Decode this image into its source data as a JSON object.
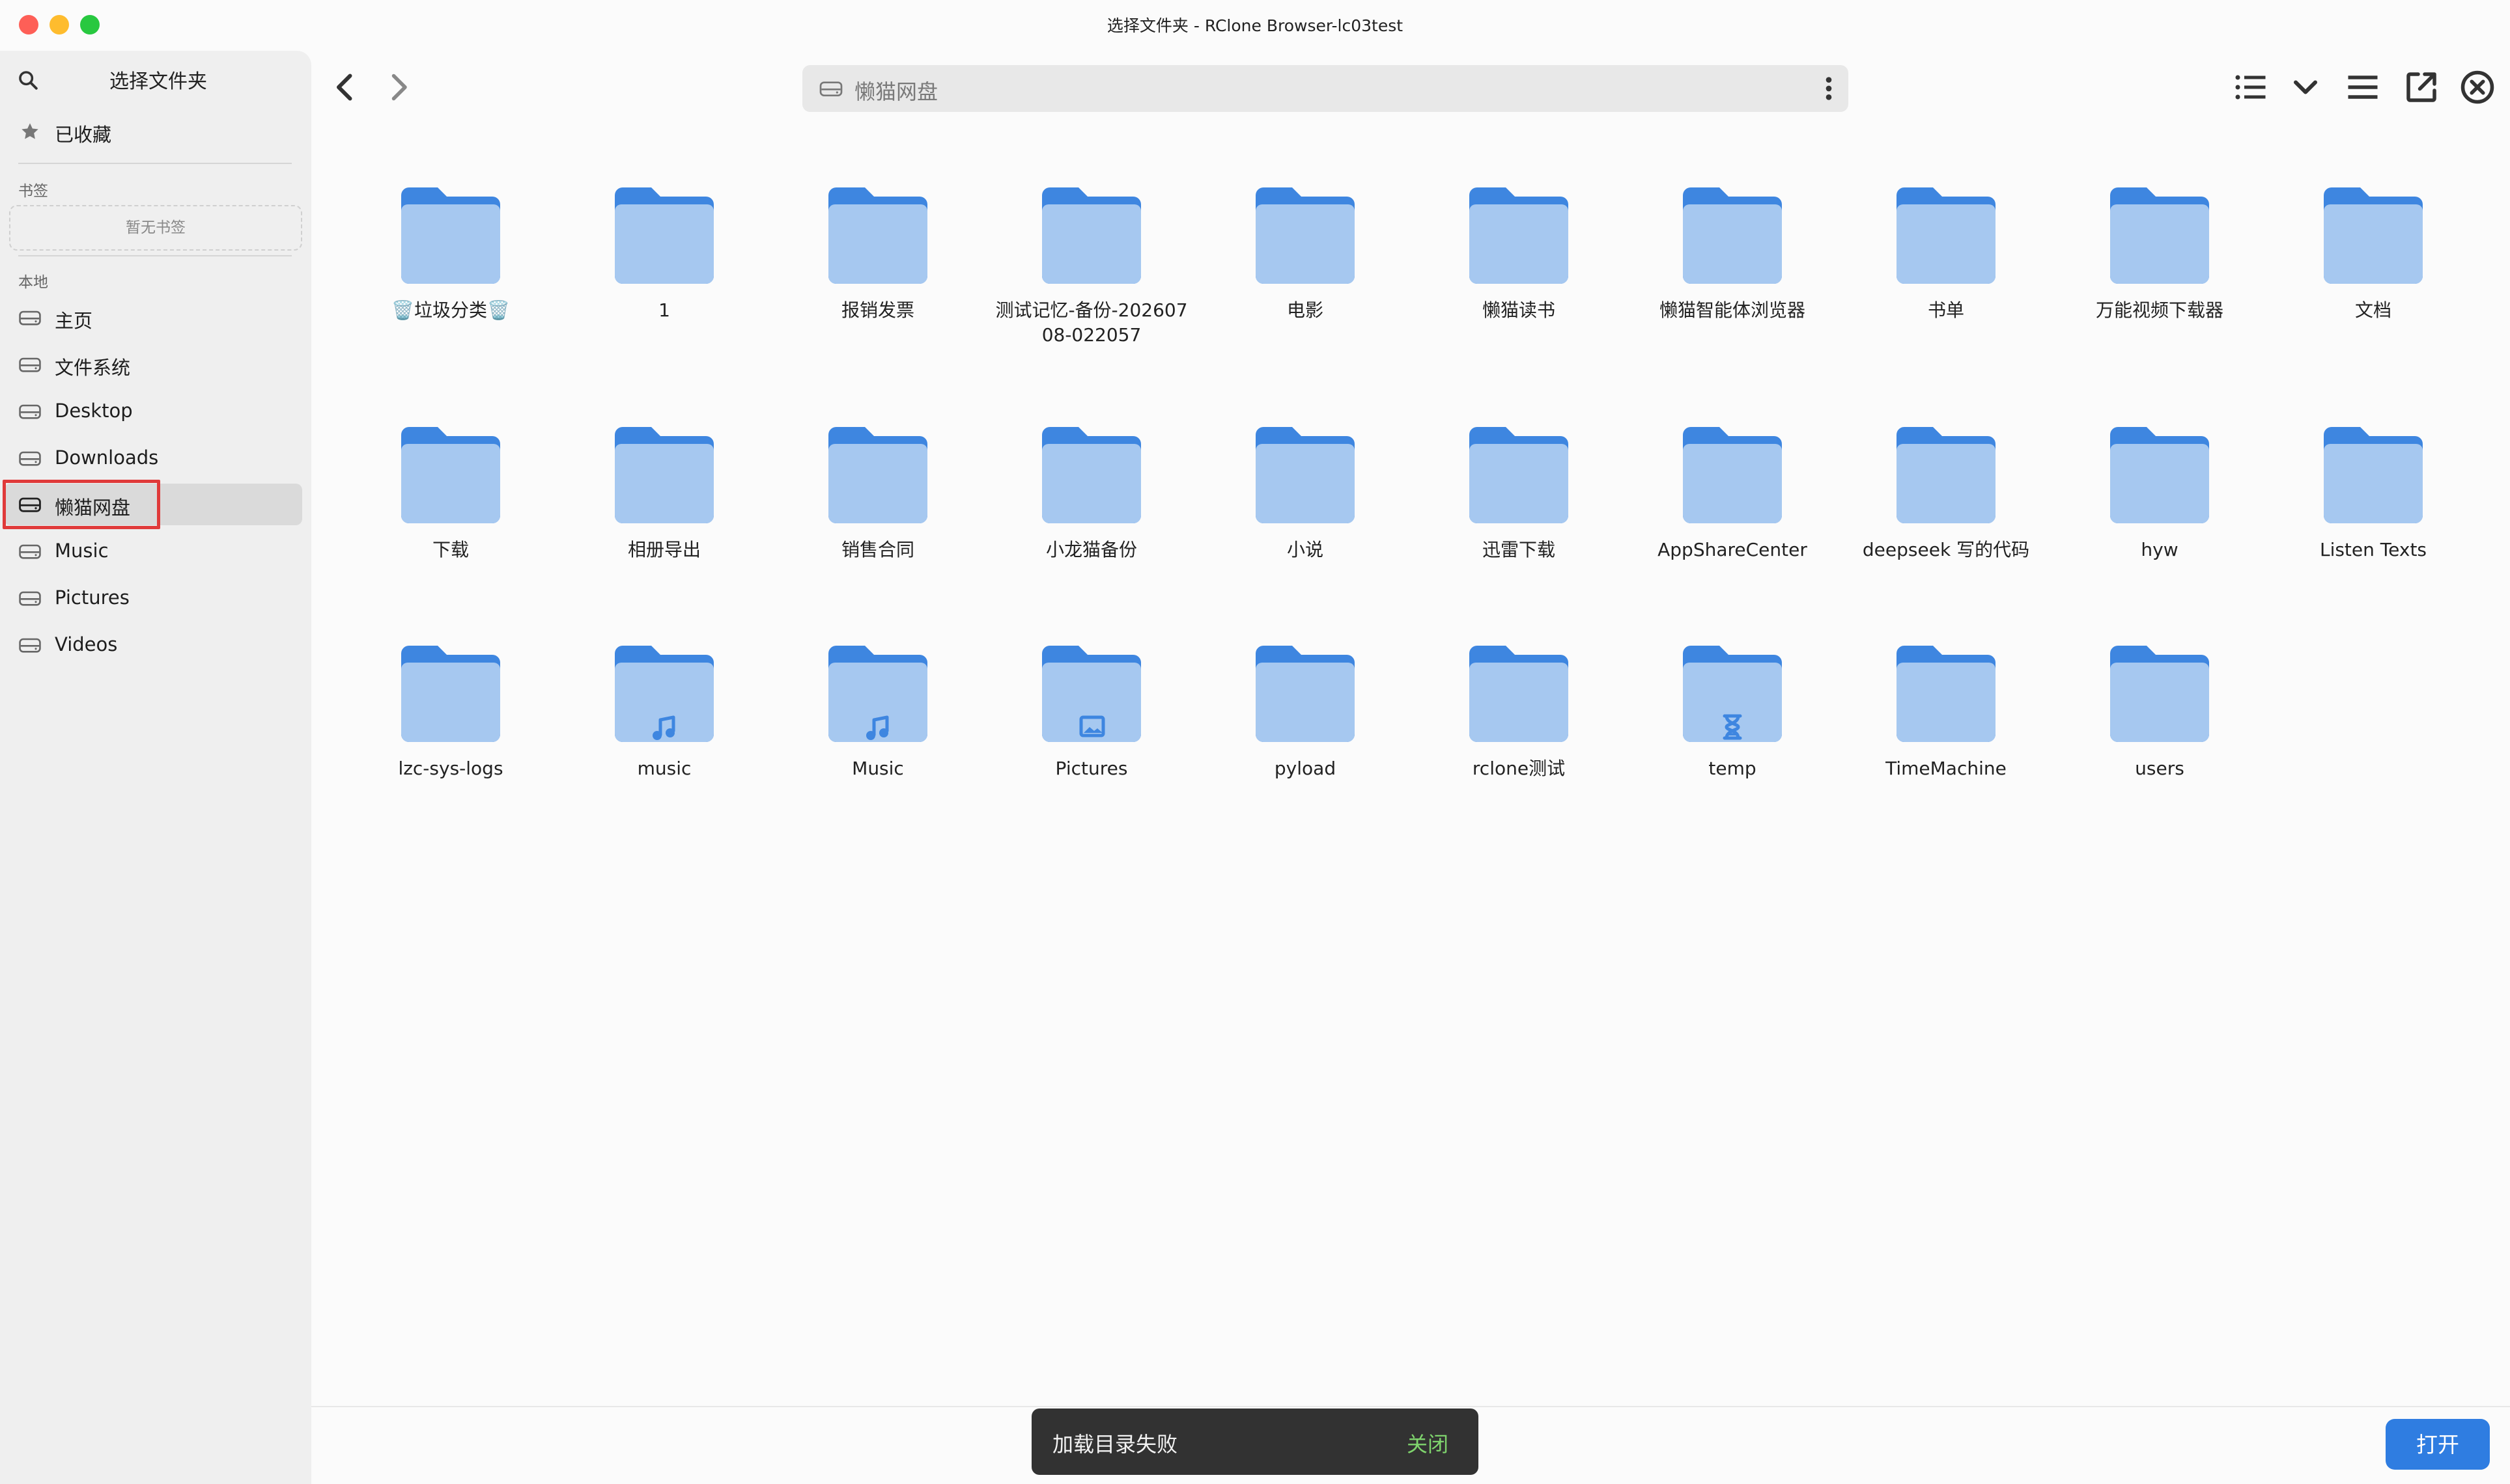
{
  "window": {
    "title": "选择文件夹 - RClone Browser-lc03test"
  },
  "sidebar": {
    "title": "选择文件夹",
    "favorites_label": "已收藏",
    "bookmarks_section": "书签",
    "bookmarks_empty": "暂无书签",
    "local_section": "本地",
    "items": [
      {
        "label": "主页"
      },
      {
        "label": "文件系统"
      },
      {
        "label": "Desktop"
      },
      {
        "label": "Downloads"
      },
      {
        "label": "懒猫网盘"
      },
      {
        "label": "Music"
      },
      {
        "label": "Pictures"
      },
      {
        "label": "Videos"
      }
    ],
    "selected": "懒猫网盘"
  },
  "pathbar": {
    "path": "懒猫网盘"
  },
  "folders": [
    {
      "name": "🗑️垃圾分类🗑️",
      "icon": "folder-icon"
    },
    {
      "name": "1",
      "icon": "folder-icon"
    },
    {
      "name": "报销发票",
      "icon": "folder-icon"
    },
    {
      "name": "测试记忆-备份-20260708-022057",
      "icon": "folder-icon"
    },
    {
      "name": "电影",
      "icon": "folder-icon"
    },
    {
      "name": "懒猫读书",
      "icon": "folder-icon"
    },
    {
      "name": "懒猫智能体浏览器",
      "icon": "folder-icon"
    },
    {
      "name": "书单",
      "icon": "folder-icon"
    },
    {
      "name": "万能视频下载器",
      "icon": "folder-icon"
    },
    {
      "name": "文档",
      "icon": "folder-icon"
    },
    {
      "name": "下载",
      "icon": "folder-icon"
    },
    {
      "name": "相册导出",
      "icon": "folder-icon"
    },
    {
      "name": "销售合同",
      "icon": "folder-icon"
    },
    {
      "name": "小龙猫备份",
      "icon": "folder-icon"
    },
    {
      "name": "小说",
      "icon": "folder-icon"
    },
    {
      "name": "迅雷下载",
      "icon": "folder-icon"
    },
    {
      "name": "AppShareCenter",
      "icon": "folder-icon"
    },
    {
      "name": "deepseek 写的代码",
      "icon": "folder-icon"
    },
    {
      "name": "hyw",
      "icon": "folder-icon"
    },
    {
      "name": "Listen Texts",
      "icon": "folder-icon"
    },
    {
      "name": "lzc-sys-logs",
      "icon": "folder-icon"
    },
    {
      "name": "music",
      "icon": "music-folder-icon"
    },
    {
      "name": "Music",
      "icon": "music-folder-icon"
    },
    {
      "name": "Pictures",
      "icon": "pictures-folder-icon"
    },
    {
      "name": "pyload",
      "icon": "folder-icon"
    },
    {
      "name": "rclone测试",
      "icon": "folder-icon"
    },
    {
      "name": "temp",
      "icon": "hourglass-folder-icon"
    },
    {
      "name": "TimeMachine",
      "icon": "folder-icon"
    },
    {
      "name": "users",
      "icon": "folder-icon"
    }
  ],
  "toast": {
    "message": "加载目录失败",
    "action": "关闭"
  },
  "footer": {
    "open_label": "打开"
  },
  "colors": {
    "folder_back": "#3e86e0",
    "folder_front": "#a6c8f0",
    "accent": "#2f7de1",
    "selection_outline": "#e03a3a"
  }
}
